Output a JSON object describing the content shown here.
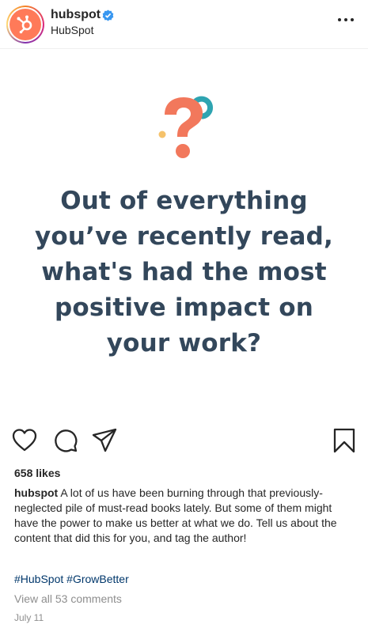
{
  "header": {
    "username": "hubspot",
    "display_name": "HubSpot",
    "verified_icon": "verified-badge-icon",
    "more_icon": "more-options-icon"
  },
  "post": {
    "question_lines": [
      "Out of everything",
      "you’ve recently read,",
      "what's had the most",
      "positive impact on",
      "your work?"
    ],
    "illustration_icon": "question-mark-icon",
    "colors": {
      "text": "#33475b",
      "orange": "#f2785c",
      "teal": "#2ea4b1",
      "yellow": "#f5c26b"
    }
  },
  "actions": {
    "like_icon": "heart-icon",
    "comment_icon": "comment-icon",
    "share_icon": "send-icon",
    "save_icon": "bookmark-icon"
  },
  "likes": "658 likes",
  "caption": {
    "author": "hubspot",
    "text": " A lot of us have been burning through that previously-neglected pile of must-read books lately. But some of them might have the power to make us better at what we do. Tell us about the content that did this for you, and tag the author!"
  },
  "hashtags": "#HubSpot #GrowBetter",
  "view_comments": "View all 53 comments",
  "date": "July 11"
}
